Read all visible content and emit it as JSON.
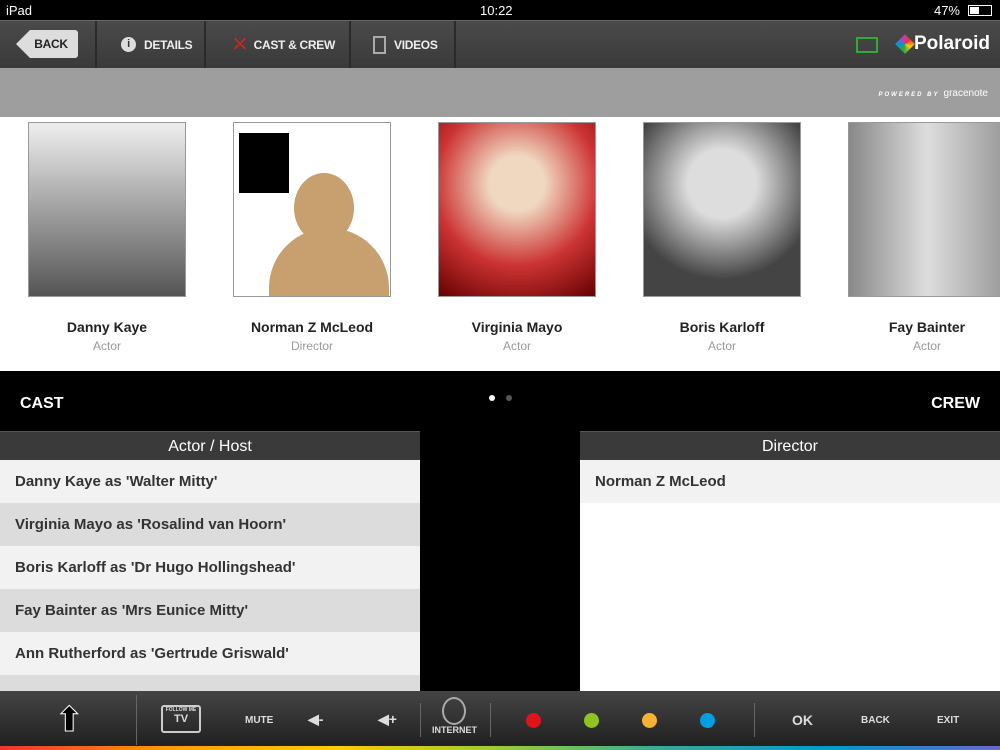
{
  "status": {
    "device": "iPad",
    "time": "10:22",
    "battery": "47%"
  },
  "nav": {
    "back": "BACK",
    "tabs": [
      "DETAILS",
      "CAST & CREW",
      "VIDEOS"
    ],
    "brand": "Polaroid"
  },
  "powered": {
    "label": "POWERED BY",
    "brand": "gracenote"
  },
  "people": [
    {
      "name": "Danny Kaye",
      "role": "Actor"
    },
    {
      "name": "Norman Z McLeod",
      "role": "Director"
    },
    {
      "name": "Virginia Mayo",
      "role": "Actor"
    },
    {
      "name": "Boris Karloff",
      "role": "Actor"
    },
    {
      "name": "Fay Bainter",
      "role": "Actor"
    }
  ],
  "pager": {
    "pages": 2,
    "current": 1
  },
  "sections": {
    "cast": "CAST",
    "crew": "CREW"
  },
  "cast": {
    "header": "Actor / Host",
    "rows": [
      "Danny Kaye as 'Walter Mitty'",
      "Virginia Mayo as 'Rosalind van Hoorn'",
      "Boris Karloff as 'Dr Hugo Hollingshead'",
      "Fay Bainter as 'Mrs Eunice Mitty'",
      "Ann Rutherford as 'Gertrude Griswald'"
    ]
  },
  "crew": {
    "header": "Director",
    "rows": [
      "Norman Z McLeod"
    ]
  },
  "remote": {
    "follow": "FOLLOW ME",
    "tv": "TV",
    "mute": "MUTE",
    "voldown": "◀-",
    "volup": "◀+",
    "internet": "INTERNET",
    "ok": "OK",
    "back": "BACK",
    "exit": "EXIT",
    "colors": [
      "#e0131b",
      "#8fc31f",
      "#f8b133",
      "#009fe3"
    ]
  }
}
